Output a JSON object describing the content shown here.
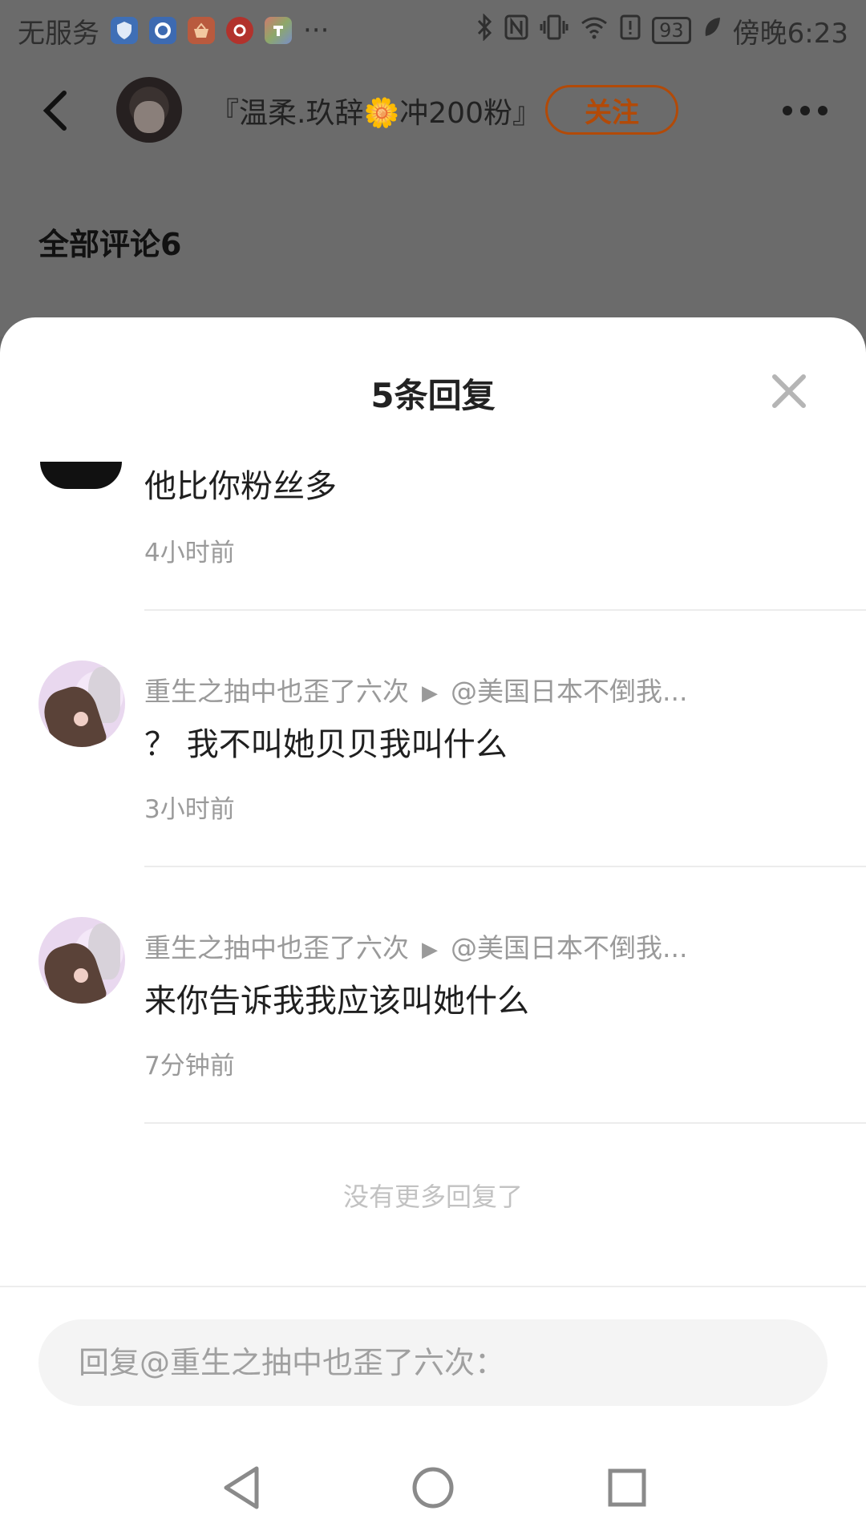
{
  "status_bar": {
    "carrier": "无服务",
    "more_indicator": "···",
    "battery": "93",
    "time": "傍晚6:23",
    "app_icons": [
      "shield-app-icon",
      "circle-app-icon",
      "basket-app-icon",
      "music-app-icon",
      "store-app-icon"
    ]
  },
  "header": {
    "user_name": "『温柔.玖辞🌼冲200粉』",
    "follow_label": "关注",
    "section_title": "全部评论6"
  },
  "sheet": {
    "title": "5条回复",
    "partial_reply": {
      "text": "他比你粉丝多",
      "time": "4小时前"
    },
    "replies": [
      {
        "author": "重生之抽中也歪了六次",
        "target": "@美国日本不倒我...",
        "text": "？ 我不叫她贝贝我叫什么",
        "time": "3小时前"
      },
      {
        "author": "重生之抽中也歪了六次",
        "target": "@美国日本不倒我...",
        "text": "来你告诉我我应该叫她什么",
        "time": "7分钟前"
      }
    ],
    "no_more": "没有更多回复了",
    "input_placeholder": "回复@重生之抽中也歪了六次："
  },
  "colors": {
    "accent": "#b24a08",
    "dim_background": "#6b6b6b",
    "muted_text": "#9a9a9a"
  }
}
